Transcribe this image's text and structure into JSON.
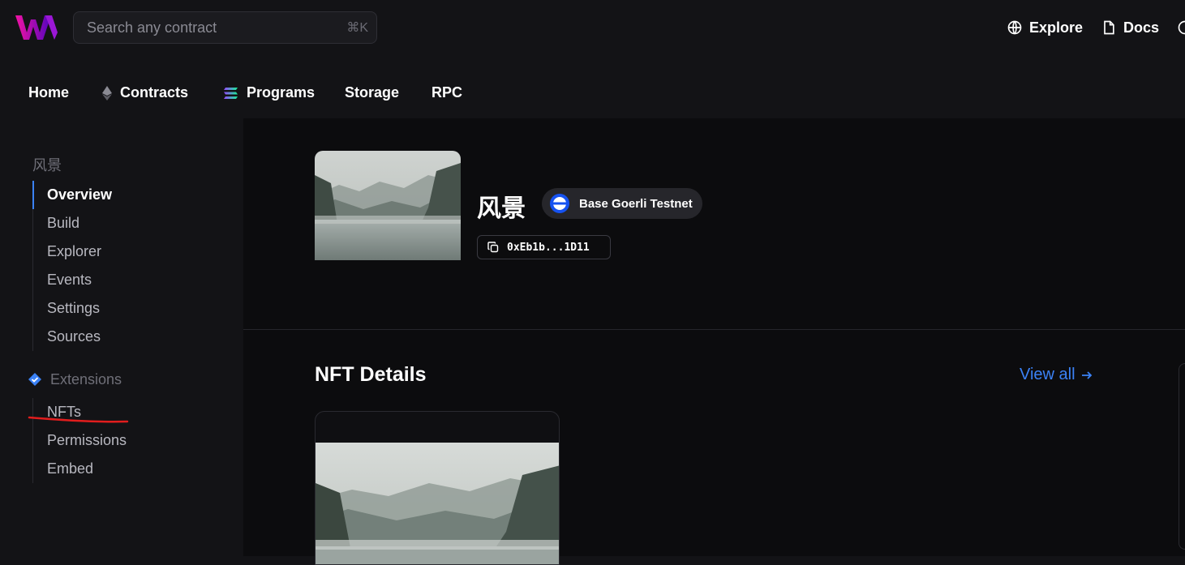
{
  "header": {
    "search_placeholder": "Search any contract",
    "search_shortcut": "⌘K",
    "links": [
      {
        "label": "Explore",
        "icon": "globe-icon"
      },
      {
        "label": "Docs",
        "icon": "document-icon"
      }
    ],
    "brand_color": "#c026d3"
  },
  "nav": {
    "items": [
      {
        "label": "Home"
      },
      {
        "label": "Contracts",
        "icon": "ethereum-icon"
      },
      {
        "label": "Programs",
        "icon": "solana-icon"
      },
      {
        "label": "Storage"
      },
      {
        "label": "RPC"
      }
    ]
  },
  "sidebar": {
    "contract_title": "风景",
    "items": [
      "Overview",
      "Build",
      "Explorer",
      "Events",
      "Settings",
      "Sources"
    ],
    "active_item": "Overview",
    "extensions_title": "Extensions",
    "extension_items": [
      "NFTs",
      "Permissions",
      "Embed"
    ]
  },
  "contract": {
    "name": "风景",
    "chain": "Base Goerli Testnet",
    "address": "0xEb1b...1D11"
  },
  "nft_section": {
    "title": "NFT Details",
    "view_all": "View all"
  },
  "colors": {
    "accent": "#3b82f6",
    "annotation_red": "#e11d1d"
  }
}
